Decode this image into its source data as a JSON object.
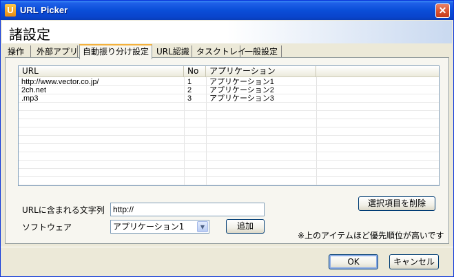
{
  "window": {
    "title": "URL Picker",
    "app_icon_letter": "U",
    "close_glyph": "✕"
  },
  "header": {
    "title": "諸設定"
  },
  "tabs": [
    {
      "label": "操作"
    },
    {
      "label": "外部アプリ"
    },
    {
      "label": "自動振り分け設定"
    },
    {
      "label": "URL認識"
    },
    {
      "label": "タスクトレイ"
    },
    {
      "label": "一般設定"
    }
  ],
  "list": {
    "columns": [
      "URL",
      "No",
      "アプリケーション",
      ""
    ],
    "rows": [
      {
        "url": "http://www.vector.co.jp/",
        "no": "1",
        "app": "アプリケーション1"
      },
      {
        "url": "2ch.net",
        "no": "2",
        "app": "アプリケーション2"
      },
      {
        "url": ".mp3",
        "no": "3",
        "app": "アプリケーション3"
      }
    ]
  },
  "form": {
    "url_label": "URLに含まれる文字列",
    "url_value": "http://",
    "software_label": "ソフトウェア",
    "software_value": "アプリケーション1",
    "add_button": "追加",
    "delete_button": "選択項目を削除",
    "priority_note": "※上のアイテムほど優先順位が高いです"
  },
  "footer": {
    "ok": "OK",
    "cancel": "キャンセル"
  }
}
